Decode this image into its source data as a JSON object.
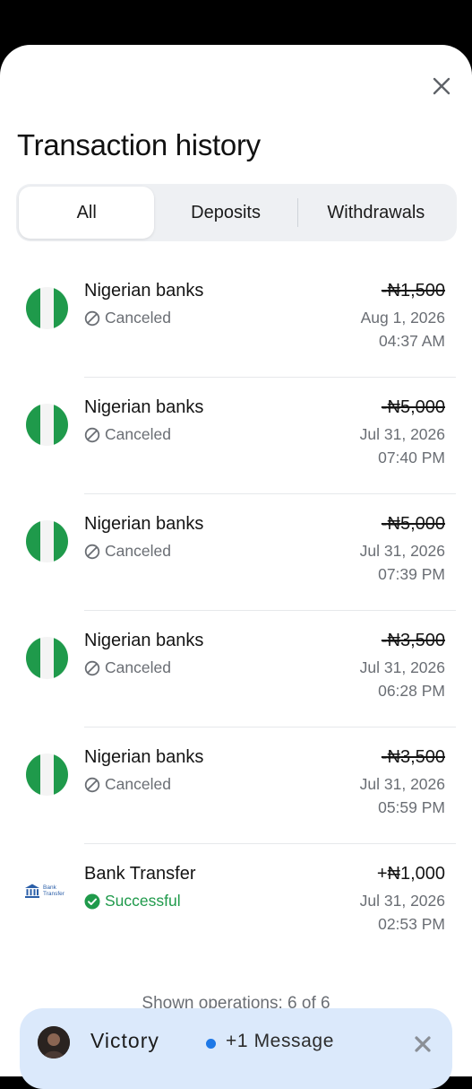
{
  "header": {
    "title": "Transaction history"
  },
  "tabs": [
    {
      "label": "All"
    },
    {
      "label": "Deposits"
    },
    {
      "label": "Withdrawals"
    }
  ],
  "transactions": [
    {
      "name": "Nigerian banks",
      "status": "Canceled",
      "amount": "-₦1,500",
      "date": "Aug 1, 2026",
      "time": "04:37 AM",
      "icon": "nigeria-flag-icon"
    },
    {
      "name": "Nigerian banks",
      "status": "Canceled",
      "amount": "-₦5,000",
      "date": "Jul 31, 2026",
      "time": "07:40 PM",
      "icon": "nigeria-flag-icon"
    },
    {
      "name": "Nigerian banks",
      "status": "Canceled",
      "amount": "-₦5,000",
      "date": "Jul 31, 2026",
      "time": "07:39 PM",
      "icon": "nigeria-flag-icon"
    },
    {
      "name": "Nigerian banks",
      "status": "Canceled",
      "amount": "-₦3,500",
      "date": "Jul 31, 2026",
      "time": "06:28 PM",
      "icon": "nigeria-flag-icon"
    },
    {
      "name": "Nigerian banks",
      "status": "Canceled",
      "amount": "-₦3,500",
      "date": "Jul 31, 2026",
      "time": "05:59 PM",
      "icon": "nigeria-flag-icon"
    },
    {
      "name": "Bank Transfer",
      "status": "Successful",
      "amount": "+₦1,000",
      "date": "Jul 31, 2026",
      "time": "02:53 PM",
      "icon": "bank-transfer-icon"
    }
  ],
  "bank_logo_text": {
    "line1": "Bank",
    "line2": "Transfer"
  },
  "footer": {
    "shown_text": "Shown operations: 6 of 6"
  },
  "chat_head": {
    "name": "Victory",
    "message": "+1 Message"
  },
  "colors": {
    "success": "#1f9a4b",
    "canceled": "#6a6e74",
    "accent_dot": "#1e78e6",
    "chat_bg": "#dbe9fb"
  }
}
